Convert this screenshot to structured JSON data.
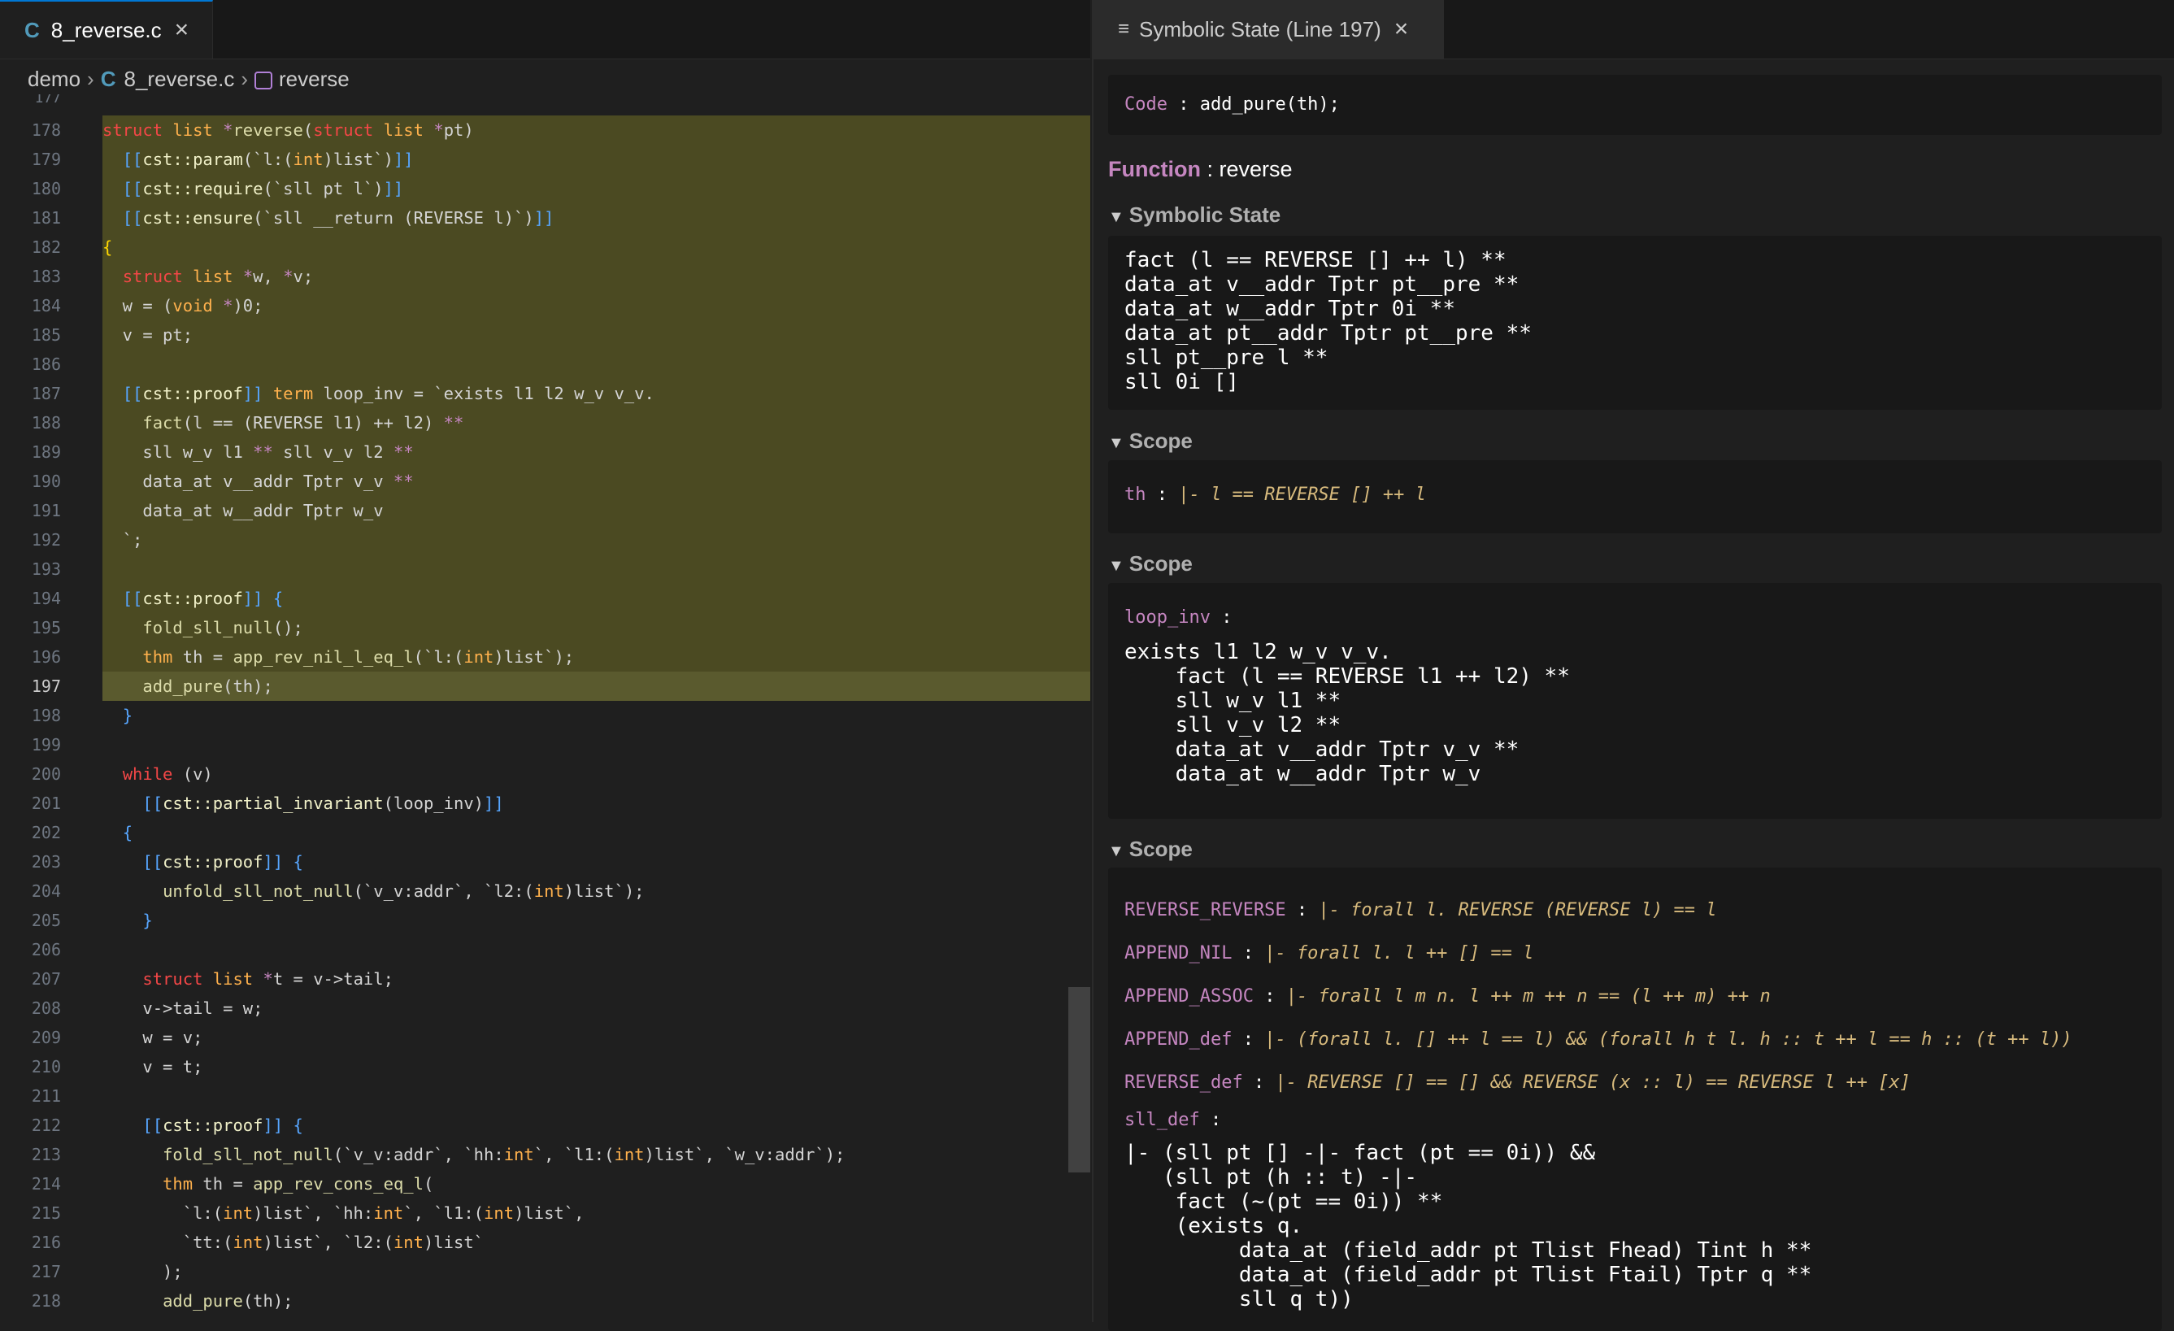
{
  "editor": {
    "tab": {
      "icon": "C",
      "label": "8_reverse.c"
    },
    "breadcrumb": {
      "folder": "demo",
      "file_icon": "C",
      "file": "8_reverse.c",
      "symbol": "reverse"
    },
    "top_partial_line_number": "177",
    "lines": [
      {
        "n": "178",
        "hl": true,
        "html": "<span class='kw'>struct</span> <span class='ty'>list</span> <span class='op'>*</span><span class='fn'>reverse</span>(<span class='kw'>struct</span> <span class='ty'>list</span> <span class='op'>*</span>pt)"
      },
      {
        "n": "179",
        "hl": true,
        "html": "  <span class='br'>[[</span><span class='at'>cst::param</span>(`l:(<span class='ty'>int</span>)list`)<span class='br'>]]</span>"
      },
      {
        "n": "180",
        "hl": true,
        "html": "  <span class='br'>[[</span><span class='at'>cst::require</span>(`sll pt l`)<span class='br'>]]</span>"
      },
      {
        "n": "181",
        "hl": true,
        "html": "  <span class='br'>[[</span><span class='at'>cst::ensure</span>(`sll __return (REVERSE l)`)<span class='br'>]]</span>"
      },
      {
        "n": "182",
        "hl": true,
        "html": "<span class='yl'>{</span>"
      },
      {
        "n": "183",
        "hl": true,
        "html": "  <span class='kw'>struct</span> <span class='ty'>list</span> <span class='op'>*</span>w, <span class='op'>*</span>v;"
      },
      {
        "n": "184",
        "hl": true,
        "html": "  w = (<span class='ty'>void</span> <span class='op'>*</span>)0;"
      },
      {
        "n": "185",
        "hl": true,
        "html": "  v = pt;"
      },
      {
        "n": "186",
        "hl": true,
        "html": ""
      },
      {
        "n": "187",
        "hl": true,
        "html": "  <span class='br'>[[</span><span class='at'>cst::proof</span><span class='br'>]]</span> <span class='ty'>term</span> loop_inv = `exists l1 l2 w_v v_v."
      },
      {
        "n": "188",
        "hl": true,
        "html": "    <span class='fn'>fact</span>(l == (REVERSE l1) ++ l2) <span class='op'>**</span>"
      },
      {
        "n": "189",
        "hl": true,
        "html": "    sll w_v l1 <span class='op'>**</span> sll v_v l2 <span class='op'>**</span>"
      },
      {
        "n": "190",
        "hl": true,
        "html": "    data_at v__addr Tptr v_v <span class='op'>**</span>"
      },
      {
        "n": "191",
        "hl": true,
        "html": "    data_at w__addr Tptr w_v"
      },
      {
        "n": "192",
        "hl": true,
        "html": "  `;"
      },
      {
        "n": "193",
        "hl": true,
        "html": ""
      },
      {
        "n": "194",
        "hl": true,
        "html": "  <span class='br'>[[</span><span class='at'>cst::proof</span><span class='br'>]]</span> <span class='br'>{</span>"
      },
      {
        "n": "195",
        "hl": true,
        "html": "    <span class='fn'>fold_sll_null</span>();"
      },
      {
        "n": "196",
        "hl": true,
        "html": "    <span class='ty'>thm</span> th = <span class='fn'>app_rev_nil_l_eq_l</span>(`l:(<span class='ty'>int</span>)list`);"
      },
      {
        "n": "197",
        "hl": true,
        "cur": true,
        "html": "    <span class='fn'>add_pure</span>(th);"
      },
      {
        "n": "198",
        "hl": false,
        "html": "  <span class='br'>}</span>"
      },
      {
        "n": "199",
        "hl": false,
        "html": ""
      },
      {
        "n": "200",
        "hl": false,
        "html": "  <span class='kw'>while</span> (v)"
      },
      {
        "n": "201",
        "hl": false,
        "html": "    <span class='br'>[[</span><span class='at'>cst::partial_invariant</span>(loop_inv)<span class='br'>]]</span>"
      },
      {
        "n": "202",
        "hl": false,
        "html": "  <span class='br'>{</span>"
      },
      {
        "n": "203",
        "hl": false,
        "html": "    <span class='br'>[[</span><span class='at'>cst::proof</span><span class='br'>]]</span> <span class='br'>{</span>"
      },
      {
        "n": "204",
        "hl": false,
        "html": "      <span class='fn'>unfold_sll_not_null</span>(`v_v:addr`, `l2:(<span class='ty'>int</span>)list`);"
      },
      {
        "n": "205",
        "hl": false,
        "html": "    <span class='br'>}</span>"
      },
      {
        "n": "206",
        "hl": false,
        "html": ""
      },
      {
        "n": "207",
        "hl": false,
        "html": "    <span class='kw'>struct</span> <span class='ty'>list</span> <span class='op'>*</span>t = v-&gt;tail;"
      },
      {
        "n": "208",
        "hl": false,
        "html": "    v-&gt;tail = w;"
      },
      {
        "n": "209",
        "hl": false,
        "html": "    w = v;"
      },
      {
        "n": "210",
        "hl": false,
        "html": "    v = t;"
      },
      {
        "n": "211",
        "hl": false,
        "html": ""
      },
      {
        "n": "212",
        "hl": false,
        "html": "    <span class='br'>[[</span><span class='at'>cst::proof</span><span class='br'>]]</span> <span class='br'>{</span>"
      },
      {
        "n": "213",
        "hl": false,
        "html": "      <span class='fn'>fold_sll_not_null</span>(`v_v:addr`, `hh:<span class='ty'>int</span>`, `l1:(<span class='ty'>int</span>)list`, `w_v:addr`);"
      },
      {
        "n": "214",
        "hl": false,
        "html": "      <span class='ty'>thm</span> th = <span class='fn'>app_rev_cons_eq_l</span>("
      },
      {
        "n": "215",
        "hl": false,
        "html": "        `l:(<span class='ty'>int</span>)list`, `hh:<span class='ty'>int</span>`, `l1:(<span class='ty'>int</span>)list`,"
      },
      {
        "n": "216",
        "hl": false,
        "html": "        `tt:(<span class='ty'>int</span>)list`, `l2:(<span class='ty'>int</span>)list`"
      },
      {
        "n": "217",
        "hl": false,
        "html": "      );"
      },
      {
        "n": "218",
        "hl": false,
        "html": "      <span class='fn'>add_pure</span>(th);"
      }
    ]
  },
  "panel": {
    "tab": {
      "label": "Symbolic State (Line 197)"
    },
    "code_label": "Code",
    "code_value": "add_pure(th);",
    "function_label": "Function",
    "function_value": "reverse",
    "symbolic_state_header": "Symbolic State",
    "symbolic_state_lines": "fact (l == REVERSE [] ++ l) **\ndata_at v__addr Tptr pt__pre **\ndata_at w__addr Tptr 0i **\ndata_at pt__addr Tptr pt__pre **\nsll pt__pre l **\nsll 0i []",
    "scope1_header": "Scope",
    "scope1_name": "th",
    "scope1_value": "|- l == REVERSE [] ++ l",
    "scope2_header": "Scope",
    "scope2_name": "loop_inv",
    "scope2_body": "exists l1 l2 w_v v_v.\n    fact (l == REVERSE l1 ++ l2) **\n    sll w_v l1 **\n    sll v_v l2 **\n    data_at v__addr Tptr v_v **\n    data_at w__addr Tptr w_v",
    "scope3_header": "Scope",
    "scope3_items": [
      {
        "name": "REVERSE_REVERSE",
        "value": "|- forall l. REVERSE (REVERSE l) == l"
      },
      {
        "name": "APPEND_NIL",
        "value": "|- forall l. l ++ [] == l"
      },
      {
        "name": "APPEND_ASSOC",
        "value": "|- forall l m n. l ++ m ++ n == (l ++ m) ++ n"
      },
      {
        "name": "APPEND_def",
        "value": "|- (forall l. [] ++ l == l) && (forall h t l. h :: t ++ l == h :: (t ++ l))"
      },
      {
        "name": "REVERSE_def",
        "value": "|- REVERSE [] == [] && REVERSE (x :: l) == REVERSE l ++ [x]"
      }
    ],
    "sll_def_name": "sll_def",
    "sll_def_body": "|- (sll pt [] -|- fact (pt == 0i)) &&\n   (sll pt (h :: t) -|-\n    fact (~(pt == 0i)) **\n    (exists q.\n         data_at (field_addr pt Tlist Fhead) Tint h **\n         data_at (field_addr pt Tlist Ftail) Tptr q **\n         sll q t))"
  },
  "colors": {
    "accent": "#0078d4",
    "highlight": "#4b4a22",
    "purple": "#c586c0"
  }
}
